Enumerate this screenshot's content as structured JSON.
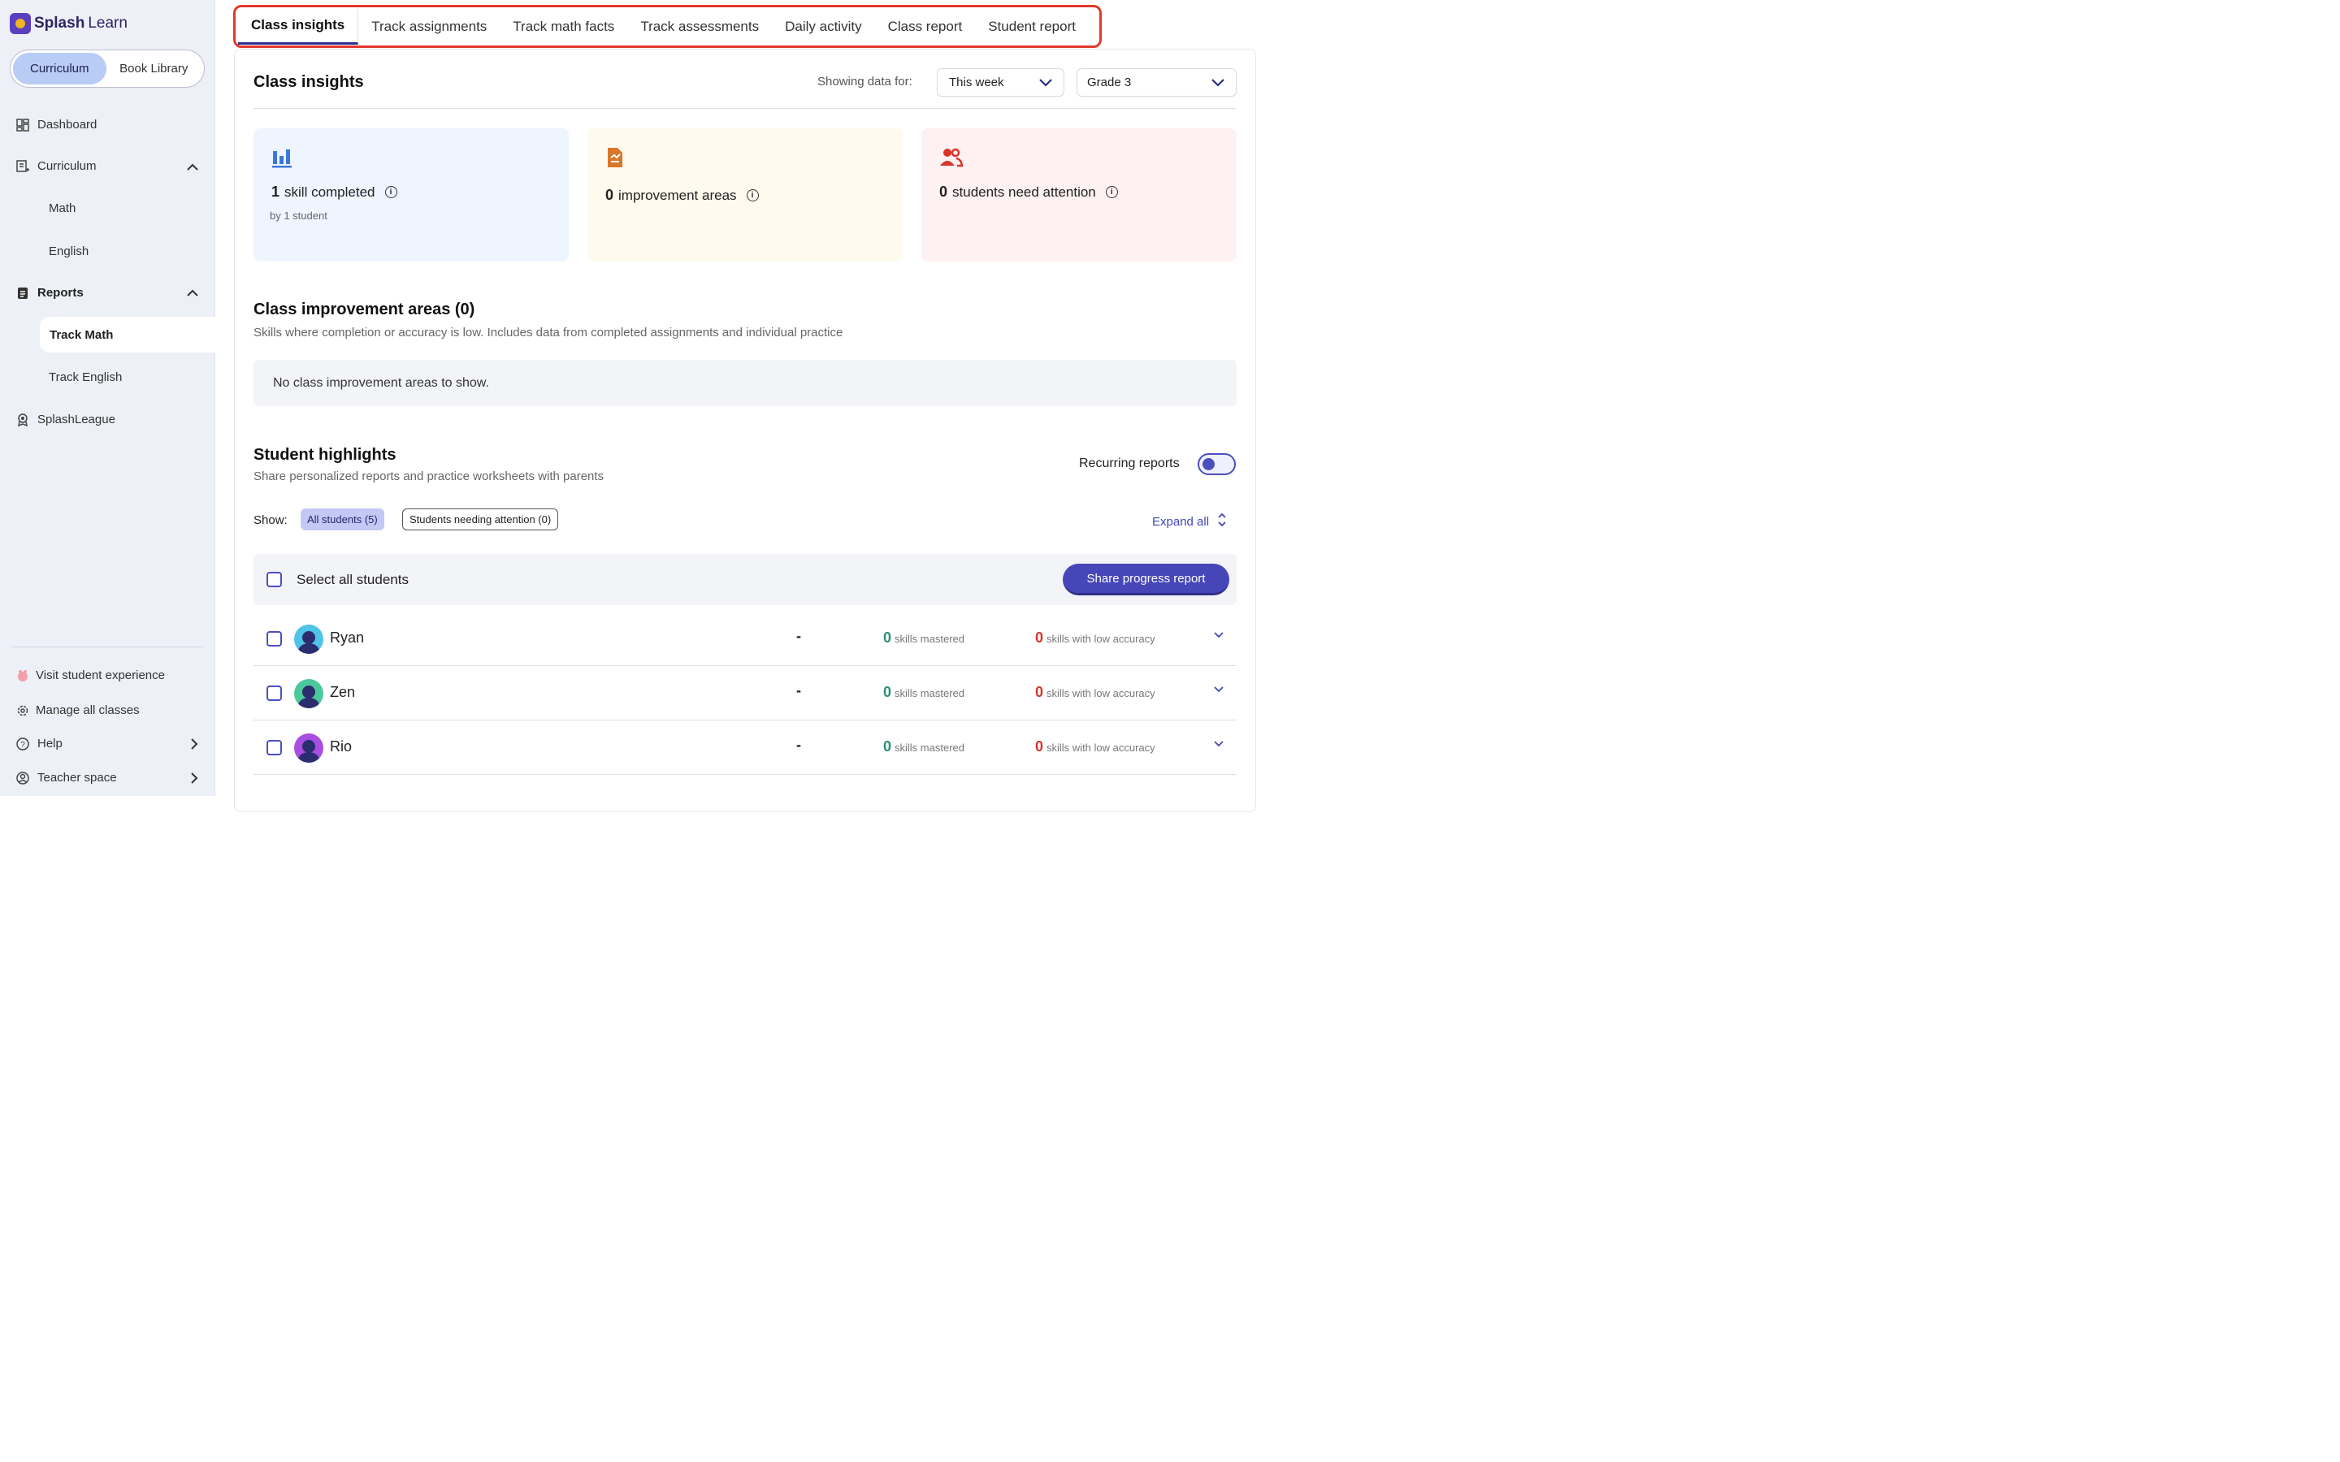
{
  "brand": {
    "name_bold": "Splash",
    "name_light": "Learn"
  },
  "sidebar": {
    "toggle": [
      "Curriculum",
      "Book Library"
    ],
    "nav": {
      "dashboard": "Dashboard",
      "curriculum": "Curriculum",
      "math": "Math",
      "english": "English",
      "reports": "Reports",
      "track_math": "Track Math",
      "track_english": "Track English",
      "splashleague": "SplashLeague"
    },
    "bottom": {
      "visit": "Visit student experience",
      "manage": "Manage all classes",
      "help": "Help",
      "teacher": "Teacher space"
    }
  },
  "tabs": [
    "Class insights",
    "Track assignments",
    "Track math facts",
    "Track assessments",
    "Daily activity",
    "Class report",
    "Student report"
  ],
  "header": {
    "title": "Class insights",
    "showing_label": "Showing data for:",
    "period": "This week",
    "grade": "Grade 3"
  },
  "cards": [
    {
      "count": "1",
      "label": "skill completed",
      "sub": "by 1 student",
      "icon": "bar-chart-icon",
      "color": "#3b78d8"
    },
    {
      "count": "0",
      "label": "improvement areas",
      "sub": "",
      "icon": "clipboard-chart-icon",
      "color": "#d9772b"
    },
    {
      "count": "0",
      "label": "students need attention",
      "sub": "",
      "icon": "users-icon",
      "color": "#d9342b"
    }
  ],
  "improvement": {
    "title": "Class improvement areas (0)",
    "subtitle": "Skills where completion or accuracy is low. Includes data from completed assignments and individual practice",
    "empty": "No class improvement areas to show."
  },
  "highlights": {
    "title": "Student highlights",
    "subtitle": "Share personalized reports and practice worksheets with parents",
    "recurring": "Recurring reports",
    "show_label": "Show:",
    "filter_all": "All students (5)",
    "filter_attention": "Students needing attention (0)",
    "expand": "Expand all",
    "select_all": "Select all students",
    "share": "Share progress report"
  },
  "students": [
    {
      "name": "Ryan",
      "dash": "-",
      "mastered": "0",
      "mastered_label": "skills mastered",
      "low": "0",
      "low_label": "skills with low accuracy",
      "avatar_color": "#4fc3e8"
    },
    {
      "name": "Zen",
      "dash": "-",
      "mastered": "0",
      "mastered_label": "skills mastered",
      "low": "0",
      "low_label": "skills with low accuracy",
      "avatar_color": "#4cc99a"
    },
    {
      "name": "Rio",
      "dash": "-",
      "mastered": "0",
      "mastered_label": "skills mastered",
      "low": "0",
      "low_label": "skills with low accuracy",
      "avatar_color": "#a84ee0"
    }
  ]
}
